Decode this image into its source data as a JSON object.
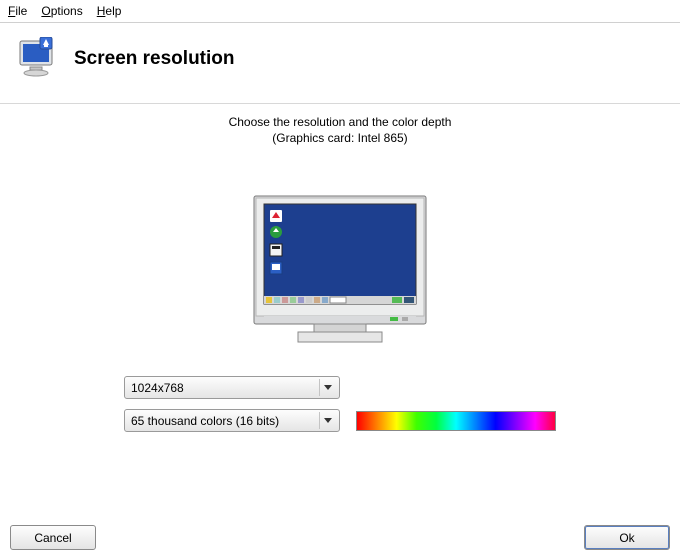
{
  "menu": {
    "file": "File",
    "options": "Options",
    "help": "Help"
  },
  "header": {
    "title": "Screen resolution"
  },
  "prompt": {
    "line1": "Choose the resolution and the color depth",
    "line2": "(Graphics card: Intel 865)"
  },
  "resolution": {
    "selected": "1024x768"
  },
  "colordepth": {
    "selected": "65 thousand colors (16 bits)"
  },
  "buttons": {
    "cancel": "Cancel",
    "ok": "Ok"
  }
}
